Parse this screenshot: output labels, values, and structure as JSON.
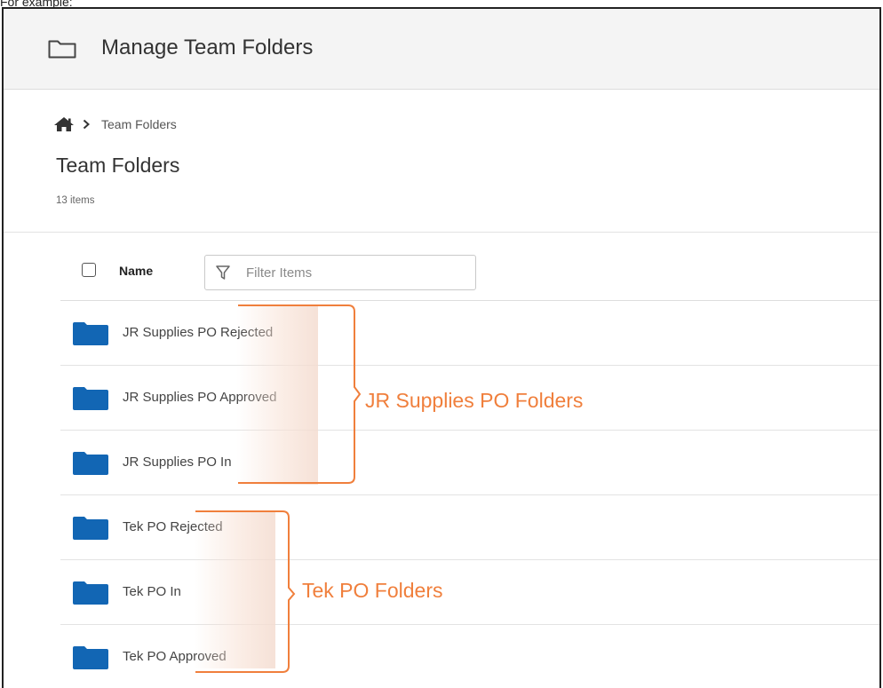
{
  "caption": "For example:",
  "app_header": {
    "title": "Manage Team Folders",
    "icon": "folder-outline-icon"
  },
  "breadcrumb": {
    "home_icon": "home-icon",
    "separator_icon": "chevron-right-icon",
    "current": "Team Folders"
  },
  "page": {
    "title": "Team Folders",
    "item_count": "13 items"
  },
  "list_header": {
    "name_label": "Name",
    "filter_placeholder": "Filter Items"
  },
  "folders": [
    {
      "name": "JR Supplies PO Rejected"
    },
    {
      "name": "JR Supplies PO Approved"
    },
    {
      "name": "JR Supplies PO In"
    },
    {
      "name": "Tek PO Rejected"
    },
    {
      "name": "Tek PO In"
    },
    {
      "name": "Tek PO Approved"
    }
  ],
  "annotations": [
    {
      "label": "JR Supplies PO Folders"
    },
    {
      "label": "Tek PO Folders"
    }
  ],
  "colors": {
    "folder": "#1266b4",
    "annotation": "#f07f3c",
    "header_bg": "#f4f4f4"
  }
}
